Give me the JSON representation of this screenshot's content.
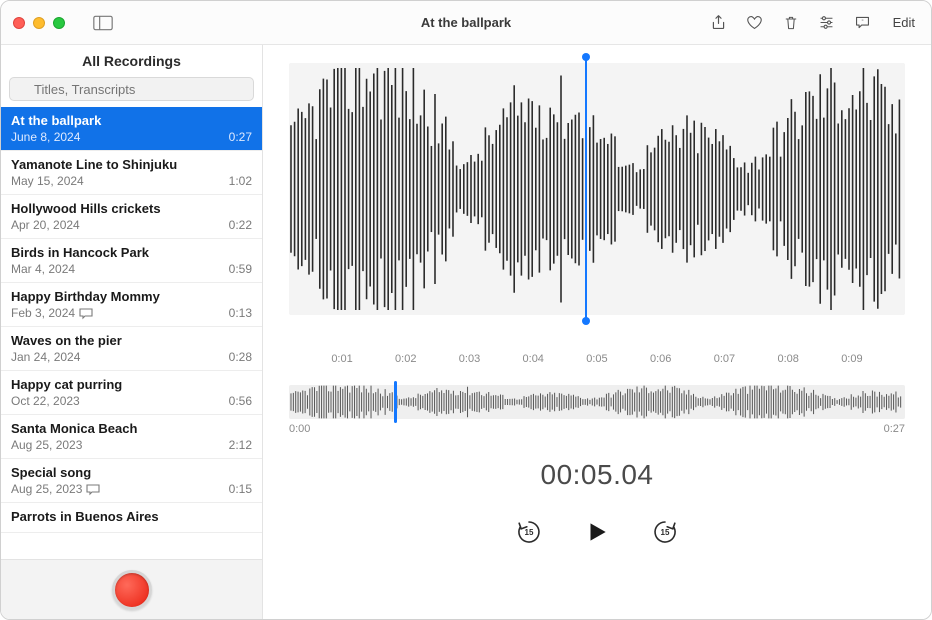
{
  "window": {
    "title": "At the ballpark"
  },
  "toolbar": {
    "edit_label": "Edit"
  },
  "sidebar": {
    "header": "All Recordings",
    "search_placeholder": "Titles, Transcripts",
    "items": [
      {
        "title": "At the ballpark",
        "date": "June 8, 2024",
        "duration": "0:27",
        "selected": true,
        "transcript": false
      },
      {
        "title": "Yamanote Line to Shinjuku",
        "date": "May 15, 2024",
        "duration": "1:02",
        "selected": false,
        "transcript": false
      },
      {
        "title": "Hollywood Hills crickets",
        "date": "Apr 20, 2024",
        "duration": "0:22",
        "selected": false,
        "transcript": false
      },
      {
        "title": "Birds in Hancock Park",
        "date": "Mar 4, 2024",
        "duration": "0:59",
        "selected": false,
        "transcript": false
      },
      {
        "title": "Happy Birthday Mommy",
        "date": "Feb 3, 2024",
        "duration": "0:13",
        "selected": false,
        "transcript": true
      },
      {
        "title": "Waves on the pier",
        "date": "Jan 24, 2024",
        "duration": "0:28",
        "selected": false,
        "transcript": false
      },
      {
        "title": "Happy cat purring",
        "date": "Oct 22, 2023",
        "duration": "0:56",
        "selected": false,
        "transcript": false
      },
      {
        "title": "Santa Monica Beach",
        "date": "Aug 25, 2023",
        "duration": "2:12",
        "selected": false,
        "transcript": false
      },
      {
        "title": "Special song",
        "date": "Aug 25, 2023",
        "duration": "0:15",
        "selected": false,
        "transcript": true
      },
      {
        "title": "Parrots in Buenos Aires",
        "date": "",
        "duration": "",
        "selected": false,
        "transcript": false
      }
    ]
  },
  "editor": {
    "big_ticks": [
      "",
      "0:01",
      "0:02",
      "0:03",
      "0:04",
      "0:05",
      "0:06",
      "0:07",
      "0:08",
      "0:09",
      ""
    ],
    "mini_start": "0:00",
    "mini_end": "0:27",
    "timecode": "00:05.04",
    "skip_seconds": "15"
  }
}
